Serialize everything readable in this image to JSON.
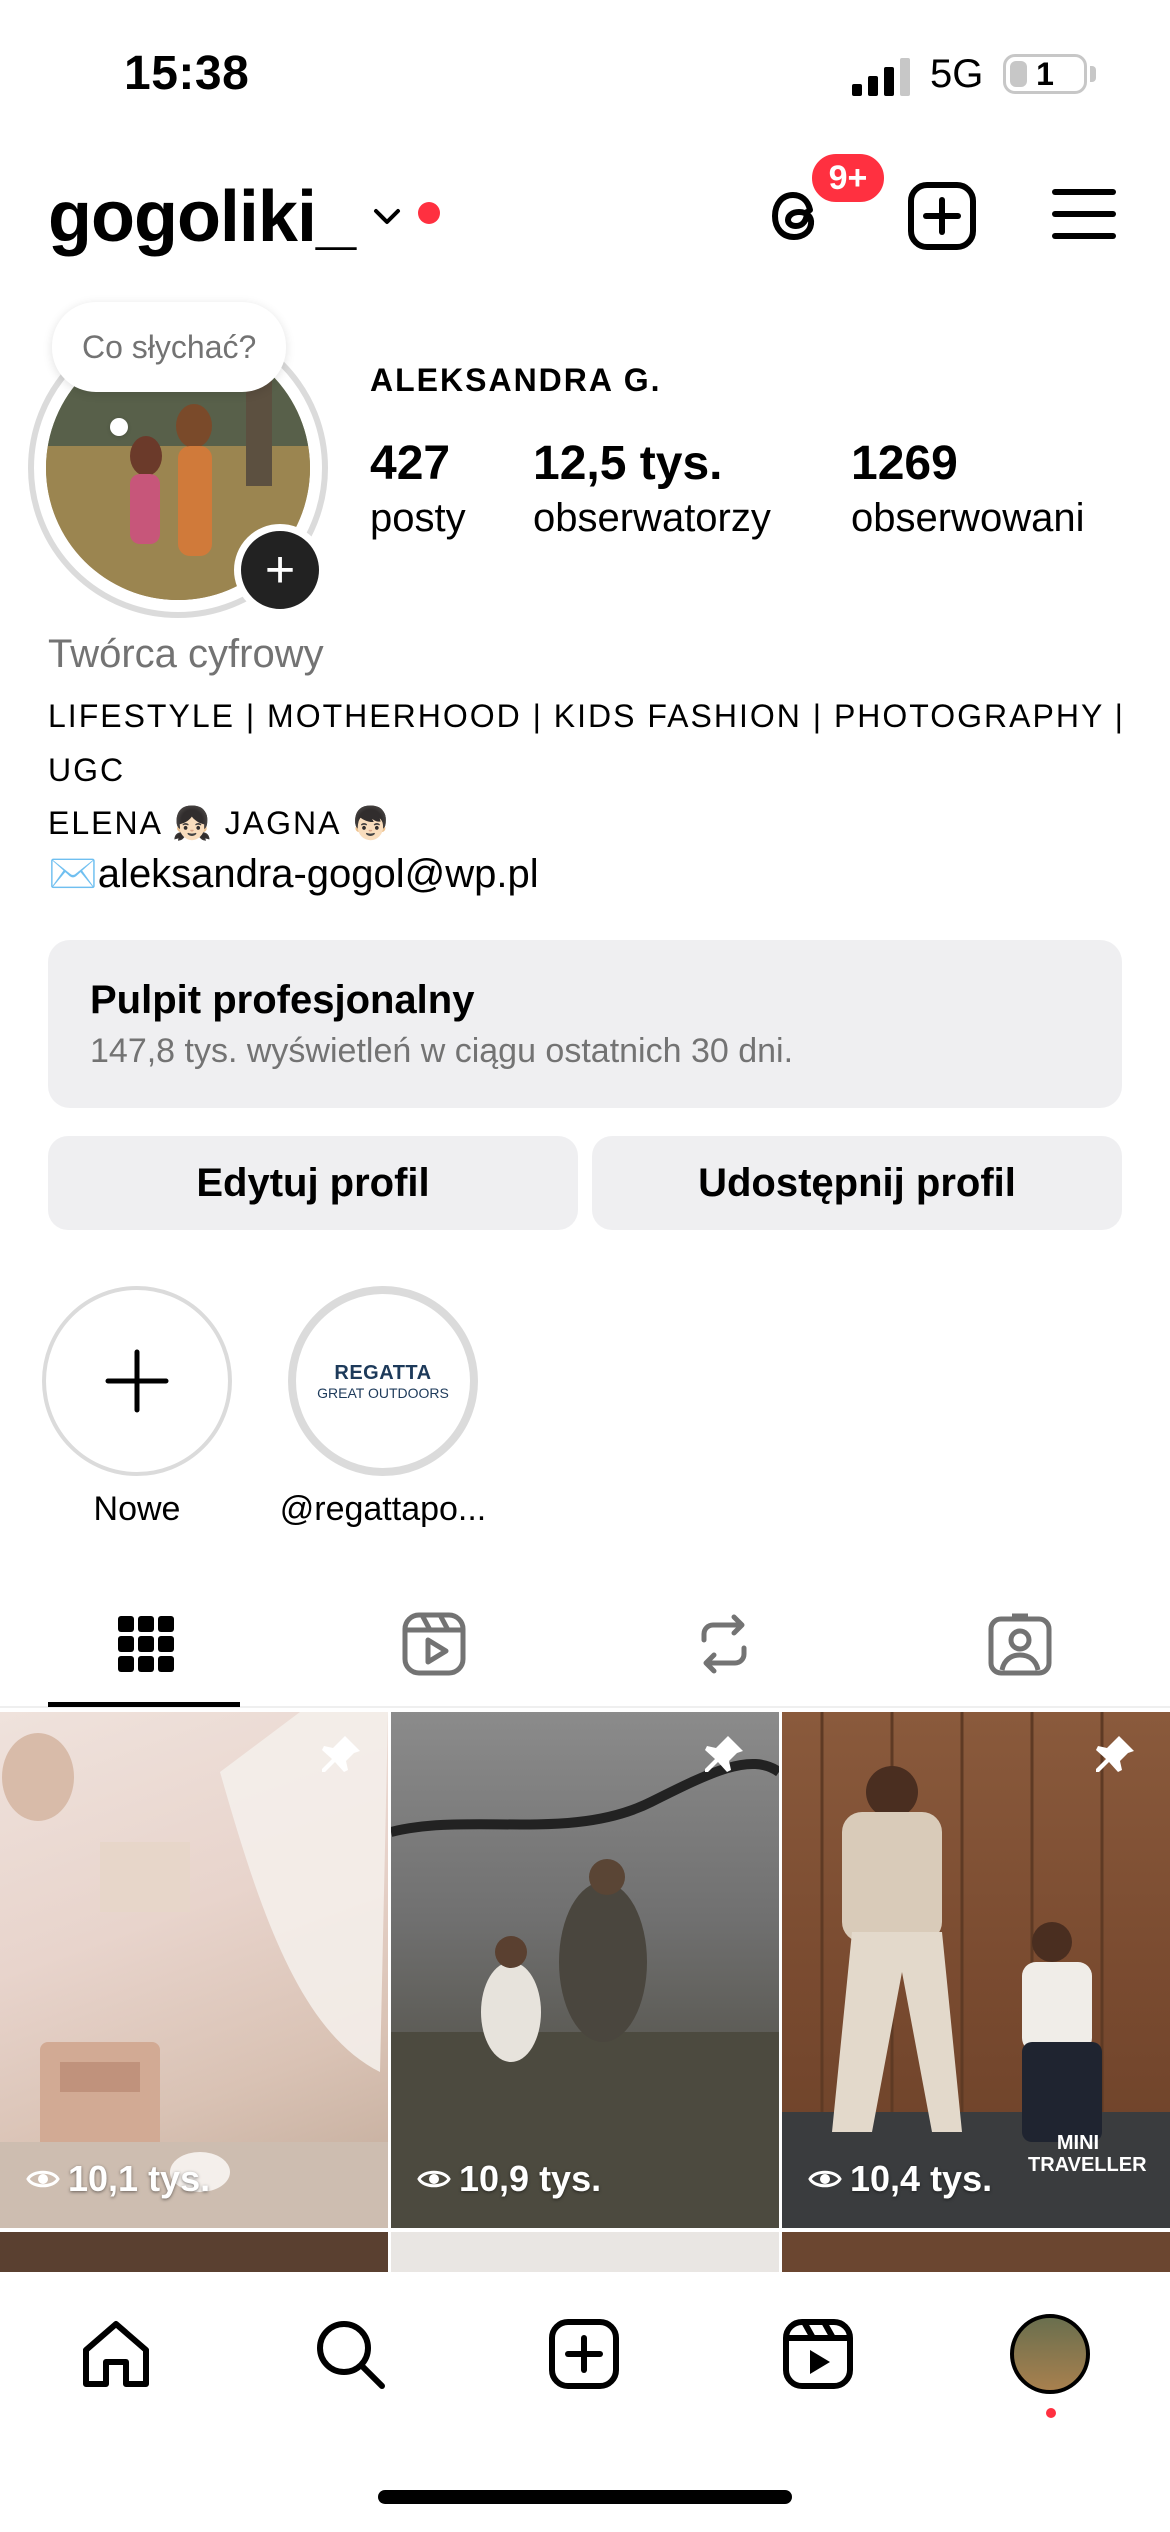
{
  "status": {
    "time": "15:38",
    "network": "5G",
    "battery": "1"
  },
  "header": {
    "username": "gogoliki_",
    "threads_badge": "9+"
  },
  "profile": {
    "note": "Co słychać?",
    "name": "ALEKSANDRA G.",
    "stats": [
      {
        "value": "427",
        "label": "posty"
      },
      {
        "value": "12,5 tys.",
        "label": "obserwatorzy"
      },
      {
        "value": "1269",
        "label": "obserwowani"
      }
    ],
    "category": "Twórca cyfrowy",
    "bio_line1": "LIFESTYLE | MOTHERHOOD | KIDS FASHION | PHOTOGRAPHY |",
    "bio_line2": "UGC",
    "bio_line3": "ELENA 👧🏻 JAGNA 👦🏻",
    "email": "✉️aleksandra-gogol@wp.pl"
  },
  "dashboard": {
    "title": "Pulpit profesjonalny",
    "subtitle": "147,8 tys. wyświetleń w ciągu ostatnich 30 dni."
  },
  "buttons": {
    "edit": "Edytuj profil",
    "share": "Udostępnij profil"
  },
  "highlights": [
    {
      "label": "Nowe"
    },
    {
      "label": "@regattapo...",
      "logo_line1": "REGATTA",
      "logo_line2": "GREAT OUTDOORS"
    }
  ],
  "grid": [
    {
      "views": "10,1 tys.",
      "pinned": true
    },
    {
      "views": "10,9 tys.",
      "pinned": true
    },
    {
      "views": "10,4 tys.",
      "pinned": true,
      "overlay_text_1": "MINI",
      "overlay_text_2": "TRAVELLER"
    }
  ],
  "colors": {
    "accent_red": "#ff3040",
    "muted": "#737373",
    "surface": "#efeff1"
  }
}
